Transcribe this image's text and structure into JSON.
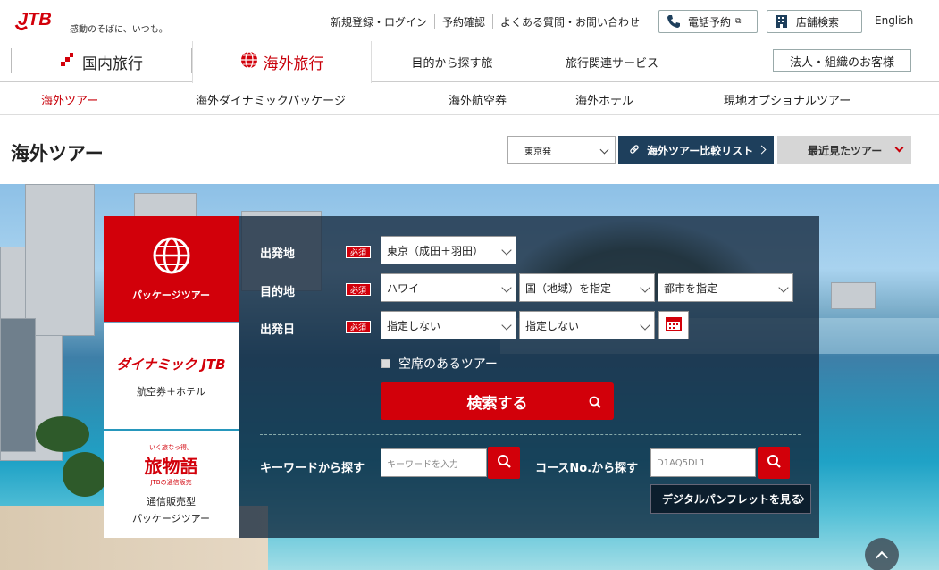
{
  "header": {
    "tagline": "感動のそばに、いつも。",
    "links": [
      "新規登録・ログイン",
      "予約確認",
      "よくある質問・お問い合わせ"
    ],
    "phone_label": "電話予約",
    "store_label": "店舗検索",
    "english_label": "English"
  },
  "mainnav": {
    "domestic": "国内旅行",
    "overseas": "海外旅行",
    "purpose": "目的から探す旅",
    "services": "旅行関連サービス",
    "corporate": "法人・組織のお客様"
  },
  "subnav": [
    "海外ツアー",
    "海外ダイナミックパッケージ",
    "海外航空券",
    "海外ホテル",
    "現地オプショナルツアー"
  ],
  "page": {
    "title": "海外ツアー",
    "departure": "東京発",
    "compare": "海外ツアー比較リスト",
    "recent": "最近見たツアー"
  },
  "tabs": {
    "package": "パッケージツアー",
    "dynamic_logo": "ダイナミック JTB",
    "dynamic_label": "航空券＋ホテル",
    "tabimonogatari_logo": "旅物語",
    "tabimonogatari_small": "いく旅なっ得。",
    "tabimonogatari_sub": "JTBの通信販売",
    "mailorder_line1": "通信販売型",
    "mailorder_line2": "パッケージツアー"
  },
  "search": {
    "depart_label": "出発地",
    "dest_label": "目的地",
    "date_label": "出発日",
    "required": "必須",
    "depart_value": "東京（成田＋羽田）",
    "dest_value": "ハワイ",
    "country_value": "国（地域）を指定",
    "city_value": "都市を指定",
    "date_from": "指定しない",
    "date_to": "指定しない",
    "vacancy_label": "空席のあるツアー",
    "search_button": "検索する",
    "keyword_label": "キーワードから探す",
    "keyword_placeholder": "キーワードを入力",
    "course_label": "コースNo.から探す",
    "course_placeholder": "D1AQ5DL1",
    "pamphlet_button": "デジタルパンフレットを見る"
  },
  "colors": {
    "brand_red": "#d2000a",
    "navy": "#1e3f5c"
  }
}
